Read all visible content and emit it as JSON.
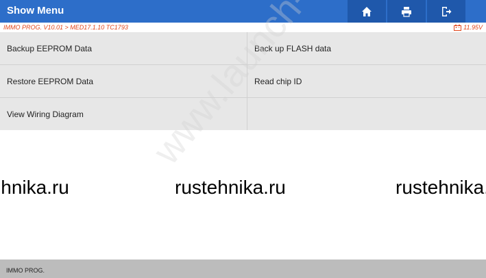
{
  "header": {
    "title": "Show Menu",
    "buttons": [
      {
        "icon": "home-icon"
      },
      {
        "icon": "print-icon"
      },
      {
        "icon": "exit-icon"
      }
    ]
  },
  "path": {
    "text": "IMMO PROG. V10.01 > MED17.1.10 TC1793",
    "voltage": "11.95V"
  },
  "menu": {
    "items": [
      "Backup EEPROM Data",
      "Back up FLASH data",
      "Restore EEPROM Data",
      "Read chip ID",
      "View Wiring Diagram",
      ""
    ]
  },
  "watermark": {
    "texts": [
      "rustehnika.ru",
      "rustehnika.ru",
      "rustehnika.ru"
    ],
    "diagonal": "www.launch-cis.ru"
  },
  "footer": {
    "label": "IMMO PROG."
  },
  "colors": {
    "topbar": "#2d6ec9",
    "button": "#1f58ab",
    "path_text": "#e2451a",
    "cell": "#e7e7e7",
    "footer": "#bcbcbc"
  }
}
